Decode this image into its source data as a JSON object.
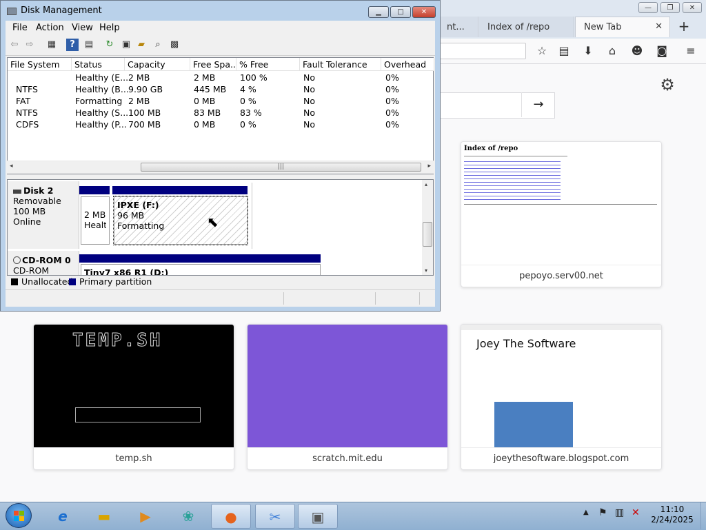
{
  "firefox": {
    "tabs": [
      {
        "label": "nt..."
      },
      {
        "label": "Index of /repo"
      },
      {
        "label": "New Tab"
      }
    ],
    "new_tab_symbol": "+",
    "tab_close_symbol": "✕",
    "window_buttons": {
      "minimize": "—",
      "restore": "❐",
      "close": "✕"
    },
    "search_go_symbol": "→",
    "top_sites": [
      {
        "caption": "pepoyo.serv00.net",
        "thumb_title": "Index of /repo"
      },
      {
        "caption": "temp.sh",
        "thumb_title": "TEMP.SH"
      },
      {
        "caption": "scratch.mit.edu",
        "thumb_title": ""
      },
      {
        "caption": "joeythesoftware.blogspot.com",
        "thumb_title": "Joey The Software"
      }
    ],
    "accent_purple": "#7d56d7"
  },
  "disk_mgmt": {
    "title": "Disk Management",
    "menu": [
      "File",
      "Action",
      "View",
      "Help"
    ],
    "columns": [
      "File System",
      "Status",
      "Capacity",
      "Free Spa...",
      "% Free",
      "Fault Tolerance",
      "Overhead"
    ],
    "rows": [
      [
        "",
        "Healthy (E...",
        "2 MB",
        "2 MB",
        "100 %",
        "No",
        "0%"
      ],
      [
        "NTFS",
        "Healthy (B...",
        "9.90 GB",
        "445 MB",
        "4 %",
        "No",
        "0%"
      ],
      [
        "FAT",
        "Formatting",
        "2 MB",
        "0 MB",
        "0 %",
        "No",
        "0%"
      ],
      [
        "NTFS",
        "Healthy (S...",
        "100 MB",
        "83 MB",
        "83 %",
        "No",
        "0%"
      ],
      [
        "CDFS",
        "Healthy (P...",
        "700 MB",
        "0 MB",
        "0 %",
        "No",
        "0%"
      ]
    ],
    "disk2": {
      "name": "Disk 2",
      "type": "Removable",
      "size": "100 MB",
      "state": "Online",
      "part1": {
        "size": "2 MB",
        "status": "Healtl"
      },
      "part2": {
        "name": "IPXE  (F:)",
        "size": "96 MB",
        "status": "Formatting"
      }
    },
    "cdrom": {
      "name": "CD-ROM 0",
      "type": "CD-ROM",
      "part": "Tiny7 x86 R1  (D:)"
    },
    "legend": {
      "unallocated": "Unallocated",
      "primary": "Primary partition"
    },
    "colors": {
      "partition_bar": "#00007f",
      "unallocated": "#000000"
    }
  },
  "taskbar": {
    "time": "11:10",
    "date": "2/24/2025"
  }
}
